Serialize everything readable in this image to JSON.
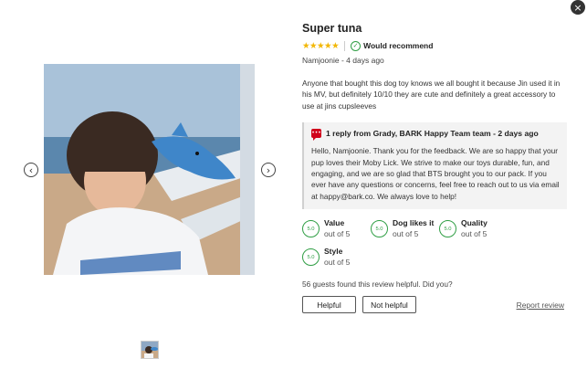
{
  "close_label": "×",
  "gallery": {
    "prev_label": "‹",
    "next_label": "›",
    "photo_icon": "review-photo",
    "thumb_icon": "review-photo-thumbnail"
  },
  "review": {
    "title": "Super tuna",
    "stars": "★★★★★",
    "rating": 5,
    "recommend": "Would recommend",
    "author_line": "Namjoonie - 4 days ago",
    "body": "Anyone that bought this dog toy knows we all bought it because Jin used it in his MV, but definitely 10/10 they are cute and definitely a great accessory to use at jins cupsleeves"
  },
  "reply": {
    "title": "1 reply from Grady, BARK Happy Team team - 2 days ago",
    "text": "Hello, Namjoonie. Thank you for the feedback. We are so happy that your pup loves their Moby Lick. We strive to make our toys durable, fun, and engaging, and we are so glad that BTS brought you to our pack. If you ever have any questions or concerns, feel free to reach out to us via email at happy@bark.co. We always love to help!"
  },
  "attributes": [
    {
      "label": "Value",
      "score": "5.0",
      "sub": "out of 5"
    },
    {
      "label": "Dog likes it",
      "score": "5.0",
      "sub": "out of 5"
    },
    {
      "label": "Quality",
      "score": "5.0",
      "sub": "out of 5"
    },
    {
      "label": "Style",
      "score": "5.0",
      "sub": "out of 5"
    }
  ],
  "helpful": {
    "question": "56 guests found this review helpful. Did you?",
    "yes_label": "Helpful",
    "no_label": "Not helpful",
    "report_label": "Report review"
  },
  "colors": {
    "accent_green": "#2f9e44",
    "star_gold": "#f2b705",
    "reply_red": "#d0021b"
  }
}
